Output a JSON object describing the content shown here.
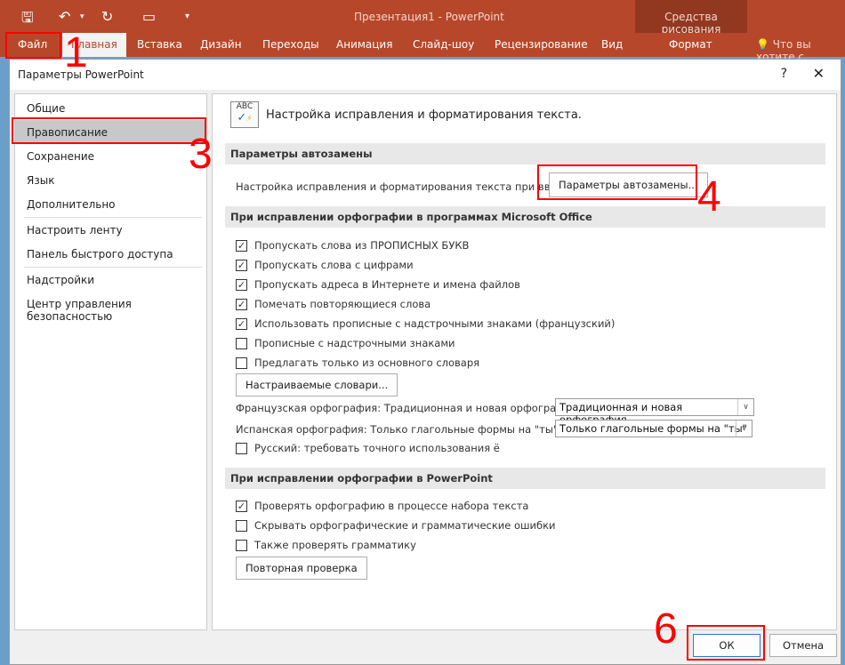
{
  "window": {
    "title": "Презентация1 - PowerPoint",
    "context_group": "Средства рисования"
  },
  "ribbon": {
    "tabs": [
      "Файл",
      "Главная",
      "Вставка",
      "Дизайн",
      "Переходы",
      "Анимация",
      "Слайд-шоу",
      "Рецензирование",
      "Вид",
      "Формат"
    ],
    "tell_me": "Что вы хотите с"
  },
  "dialog": {
    "title": "Параметры PowerPoint",
    "help": "?",
    "close": "✕",
    "sidebar": [
      "Общие",
      "Правописание",
      "Сохранение",
      "Язык",
      "Дополнительно",
      "Настроить ленту",
      "Панель быстрого доступа",
      "Надстройки",
      "Центр управления безопасностью"
    ],
    "header": "Настройка исправления и форматирования текста.",
    "autocorrect": {
      "section": "Параметры автозамены",
      "label": "Настройка исправления и форматирования текста при вводе:",
      "button": "Параметры автозамены..."
    },
    "office": {
      "section": "При исправлении орфографии в программах Microsoft Office",
      "checks": [
        {
          "label": "Пропускать слова из ПРОПИСНЫХ БУКВ",
          "checked": true
        },
        {
          "label": "Пропускать слова с цифрами",
          "checked": true
        },
        {
          "label": "Пропускать адреса в Интернете и имена файлов",
          "checked": true
        },
        {
          "label": "Помечать повторяющиеся слова",
          "checked": true
        },
        {
          "label": "Использовать прописные с надстрочными знаками (французский)",
          "checked": true
        },
        {
          "label": "Прописные с надстрочными знаками",
          "checked": false
        },
        {
          "label": "Предлагать только из основного словаря",
          "checked": false
        }
      ],
      "dict_button": "Настраиваемые словари...",
      "french_label": "Французская орфография: Традиционная и новая орфография",
      "french_value": "Традиционная и новая орфография",
      "spanish_label": "Испанская орфография: Только глагольные формы на \"ты\"",
      "spanish_value": "Только глагольные формы на \"ты\"",
      "russian": {
        "label": "Русский: требовать точного использования ё",
        "checked": false
      }
    },
    "ppt": {
      "section": "При исправлении орфографии в PowerPoint",
      "checks": [
        {
          "label": "Проверять орфографию в процессе набора текста",
          "checked": true
        },
        {
          "label": "Скрывать орфографические и грамматические ошибки",
          "checked": false
        },
        {
          "label": "Также проверять грамматику",
          "checked": false
        }
      ],
      "recheck": "Повторная проверка"
    },
    "ok": "ОК",
    "cancel": "Отмена"
  },
  "annotations": [
    "1",
    "3",
    "4",
    "6"
  ],
  "colors": {
    "accent": "#b7472a",
    "annotation": "#ff0000"
  }
}
